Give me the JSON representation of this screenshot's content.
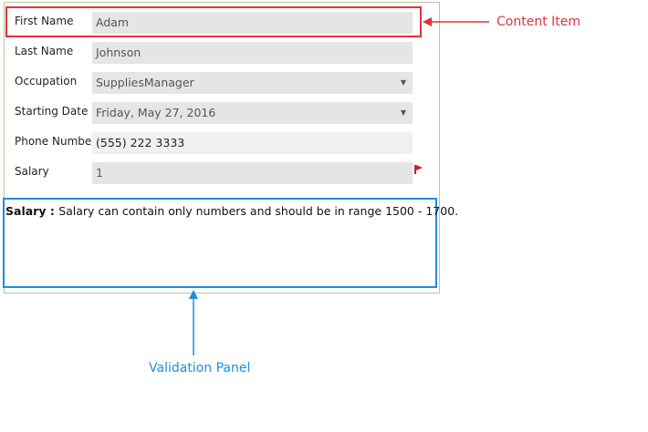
{
  "form": {
    "fields": [
      {
        "label": "First Name",
        "value": "Adam"
      },
      {
        "label": "Last Name",
        "value": "Johnson"
      },
      {
        "label": "Occupation",
        "value": "SuppliesManager"
      },
      {
        "label": "Starting Date",
        "value": "Friday, May 27, 2016"
      },
      {
        "label": "Phone Number",
        "value": "(555) 222 3333"
      },
      {
        "label": "Salary",
        "value": "1"
      }
    ]
  },
  "validation": {
    "field": "Salary",
    "separator": " : ",
    "message": "Salary can contain only numbers and should be in range 1500 - 1700."
  },
  "callouts": {
    "content_item": "Content Item",
    "validation_panel": "Validation Panel"
  },
  "colors": {
    "content_item": "#e0333d",
    "validation_panel": "#1e8ed8",
    "error_flag": "#c0262e"
  }
}
